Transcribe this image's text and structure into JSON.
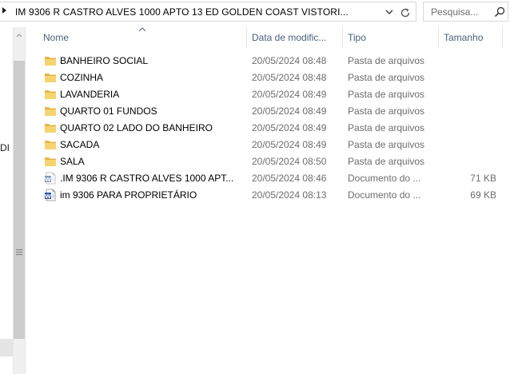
{
  "address_bar": {
    "path": "IM 9306 R CASTRO ALVES 1000 APTO 13 ED GOLDEN COAST VISTORI...",
    "refresh_icon": "refresh-icon",
    "dropdown_icon": "chevron-down-icon"
  },
  "search": {
    "placeholder": "Pesquisa...",
    "icon": "search-icon"
  },
  "nav": {
    "cut_text": "DI"
  },
  "columns": {
    "name": "Nome",
    "date": "Data de modific...",
    "type": "Tipo",
    "size": "Tamanho"
  },
  "files": [
    {
      "name": "BANHEIRO SOCIAL",
      "date": "20/05/2024 08:48",
      "type": "Pasta de arquivos",
      "size": "",
      "icon": "folder-icon"
    },
    {
      "name": "COZINHA",
      "date": "20/05/2024 08:48",
      "type": "Pasta de arquivos",
      "size": "",
      "icon": "folder-icon"
    },
    {
      "name": "LAVANDERIA",
      "date": "20/05/2024 08:49",
      "type": "Pasta de arquivos",
      "size": "",
      "icon": "folder-icon"
    },
    {
      "name": "QUARTO 01 FUNDOS",
      "date": "20/05/2024 08:49",
      "type": "Pasta de arquivos",
      "size": "",
      "icon": "folder-icon"
    },
    {
      "name": "QUARTO 02 LADO DO BANHEIRO",
      "date": "20/05/2024 08:49",
      "type": "Pasta de arquivos",
      "size": "",
      "icon": "folder-icon"
    },
    {
      "name": "SACADA",
      "date": "20/05/2024 08:49",
      "type": "Pasta de arquivos",
      "size": "",
      "icon": "folder-icon"
    },
    {
      "name": "SALA",
      "date": "20/05/2024 08:50",
      "type": "Pasta de arquivos",
      "size": "",
      "icon": "folder-icon"
    },
    {
      "name": ".IM 9306 R CASTRO ALVES 1000 APT...",
      "date": "20/05/2024 08:46",
      "type": "Documento do ...",
      "size": "71 KB",
      "icon": "word-doc-faded-icon"
    },
    {
      "name": "im 9306 PARA PROPRIETÁRIO",
      "date": "20/05/2024 08:13",
      "type": "Documento do ...",
      "size": "69 KB",
      "icon": "word-doc-icon"
    }
  ]
}
